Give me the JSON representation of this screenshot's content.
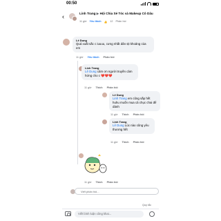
{
  "status": {
    "time": "00:50"
  },
  "header": {
    "author": "Linh Trang",
    "arrow": "▶",
    "group": "Hội Chia Sẻ Tóc và Makeup Cô Dâu",
    "time": "11 giờ",
    "like_label": "Yêu thích",
    "like_count": "12",
    "reply_label": "Phản hồi"
  },
  "comments": [
    {
      "name": "Lê Dung",
      "text": "Quá xuất sắc c iuuuu, cưng nhất dân sịt khoảng của em",
      "time": "11 giờ",
      "like": "Yêu thích",
      "reply": "Phản hồi"
    },
    {
      "name": "Linh Trang",
      "tag": "Lê Dung",
      "text": "cảm ơn người truyền cảm hứng cho c ❤️❤️❤️",
      "time": "11 giờ",
      "like": "Thích",
      "reply": "Phản hồi"
    },
    {
      "name": "Lê Dung",
      "tag": "Linh Trang",
      "text": "em cũng sắp hết huhu muốn mua cả chục chai để dành",
      "time": "11 giờ",
      "like": "Thích",
      "reply": "Phản hồi"
    },
    {
      "name": "Linh Trang",
      "tag": "Lê Dung",
      "text": "Lúc nào cũng yêu thương hết",
      "time": "11 giờ",
      "like": "Thích",
      "reply": "Phản hồi"
    },
    {
      "time": "11 giờ",
      "like": "Thích",
      "reply": "Phản hồi"
    }
  ],
  "reply_placeholder": "Viết phản hồi...",
  "rules_label": "Quy tắc",
  "composer": {
    "placeholder": "Viết bình luận công khai..."
  },
  "tabs": [
    "Bảng tin",
    "Watch",
    "Nhóm",
    "Trang",
    "Thông báo",
    "Menu"
  ]
}
